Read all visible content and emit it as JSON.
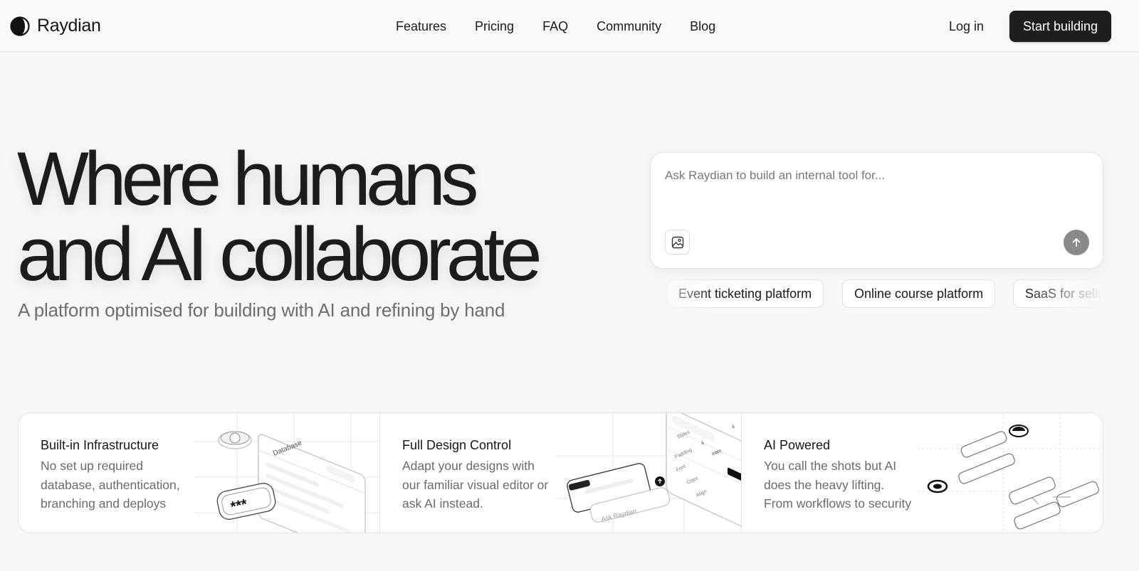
{
  "brand": {
    "name": "Raydian"
  },
  "nav": {
    "items": [
      {
        "label": "Features"
      },
      {
        "label": "Pricing"
      },
      {
        "label": "FAQ"
      },
      {
        "label": "Community"
      },
      {
        "label": "Blog"
      }
    ],
    "login_label": "Log in",
    "cta_label": "Start building"
  },
  "hero": {
    "title_line1": "Where humans",
    "title_line2": "and AI collaborate",
    "subtitle": "A platform optimised for building with AI and refining by hand"
  },
  "prompt": {
    "placeholder": "Ask Raydian to build an internal tool for...",
    "value": "",
    "image_icon": "image-icon",
    "send_icon": "arrow-up-icon"
  },
  "suggestions": [
    {
      "label": "Event ticketing platform"
    },
    {
      "label": "Online course platform"
    },
    {
      "label": "SaaS for selli"
    }
  ],
  "features": [
    {
      "title": "Built-in Infrastructure",
      "lines": [
        "No set up required",
        "database, authentication,",
        "branching and deploys"
      ],
      "art": {
        "db_label": "Database",
        "password_mask": "***"
      }
    },
    {
      "title": "Full Design Control",
      "lines": [
        "Adapt your designs with",
        "our familiar visual editor or",
        "ask AI instead."
      ],
      "art": {
        "ask_label": "Ask Raydian",
        "styles_label": "Styles",
        "padding_label": "Padding",
        "font_label": "Font",
        "font_value": "Inter",
        "color_label": "Color",
        "align_label": "Align",
        "value_4": "4"
      }
    },
    {
      "title": "AI Powered",
      "lines": [
        "You call the shots but AI",
        "does the heavy lifting.",
        "From workflows to security"
      ]
    }
  ],
  "colors": {
    "background": "#f8f7f6",
    "cta_bg": "#1e1e20",
    "send_button": "#8b8a88",
    "muted_text": "#6c6b69"
  }
}
